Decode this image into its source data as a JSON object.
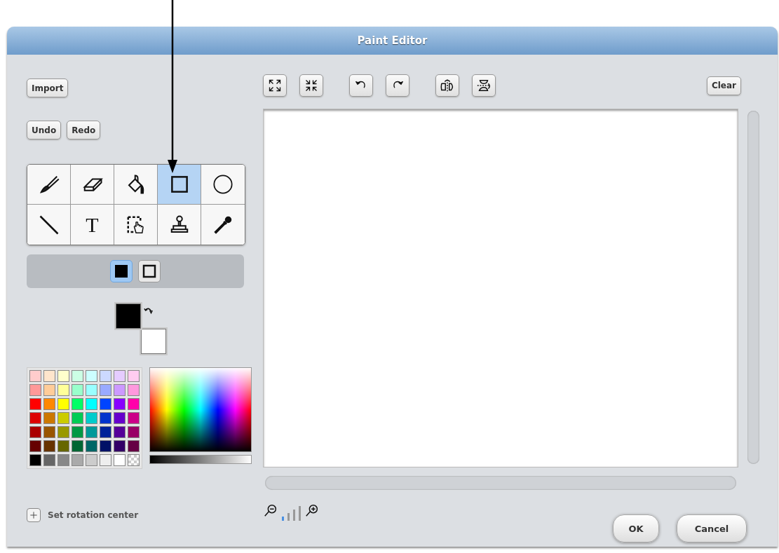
{
  "window": {
    "title": "Paint Editor"
  },
  "left_buttons": [
    {
      "label": "Import"
    },
    {
      "label": "Undo"
    },
    {
      "label": "Redo"
    }
  ],
  "tools": [
    {
      "kind": "brush",
      "selected": false
    },
    {
      "kind": "eraser",
      "selected": false
    },
    {
      "kind": "fill",
      "selected": false
    },
    {
      "kind": "rectangle",
      "selected": true
    },
    {
      "kind": "ellipse",
      "selected": false
    },
    {
      "kind": "line",
      "selected": false
    },
    {
      "kind": "text",
      "label": "T",
      "selected": false
    },
    {
      "kind": "select",
      "selected": false
    },
    {
      "kind": "stamp",
      "selected": false
    },
    {
      "kind": "eyedropper",
      "selected": false
    }
  ],
  "fill_modes": [
    {
      "kind": "filled",
      "selected": true
    },
    {
      "kind": "outline",
      "selected": false
    }
  ],
  "current_colors": [
    {
      "color": "#000000"
    },
    {
      "color": "#ffffff"
    }
  ],
  "palette": [
    {
      "kind": "solid",
      "color": "#ffcccc"
    },
    {
      "kind": "solid",
      "color": "#ffe5cc"
    },
    {
      "kind": "solid",
      "color": "#ffffcc"
    },
    {
      "kind": "solid",
      "color": "#ccffe5"
    },
    {
      "kind": "solid",
      "color": "#ccffff"
    },
    {
      "kind": "solid",
      "color": "#ccd9ff"
    },
    {
      "kind": "solid",
      "color": "#e5ccff"
    },
    {
      "kind": "solid",
      "color": "#ffccf0"
    },
    {
      "kind": "solid",
      "color": "#ff9999"
    },
    {
      "kind": "solid",
      "color": "#ffcc99"
    },
    {
      "kind": "solid",
      "color": "#ffff99"
    },
    {
      "kind": "solid",
      "color": "#99ffcc"
    },
    {
      "kind": "solid",
      "color": "#99ffff"
    },
    {
      "kind": "solid",
      "color": "#99aaff"
    },
    {
      "kind": "solid",
      "color": "#cc99ff"
    },
    {
      "kind": "solid",
      "color": "#ff99dd"
    },
    {
      "kind": "solid",
      "color": "#ff0000"
    },
    {
      "kind": "solid",
      "color": "#ff8800"
    },
    {
      "kind": "solid",
      "color": "#ffff00"
    },
    {
      "kind": "solid",
      "color": "#00ff66"
    },
    {
      "kind": "solid",
      "color": "#00ffff"
    },
    {
      "kind": "solid",
      "color": "#0044ff"
    },
    {
      "kind": "solid",
      "color": "#8800ff"
    },
    {
      "kind": "solid",
      "color": "#ff00aa"
    },
    {
      "kind": "solid",
      "color": "#dd0000"
    },
    {
      "kind": "solid",
      "color": "#cc7700"
    },
    {
      "kind": "solid",
      "color": "#cccc00"
    },
    {
      "kind": "solid",
      "color": "#00cc55"
    },
    {
      "kind": "solid",
      "color": "#00cccc"
    },
    {
      "kind": "solid",
      "color": "#0033cc"
    },
    {
      "kind": "solid",
      "color": "#6600cc"
    },
    {
      "kind": "solid",
      "color": "#cc0088"
    },
    {
      "kind": "solid",
      "color": "#aa0000"
    },
    {
      "kind": "solid",
      "color": "#995500"
    },
    {
      "kind": "solid",
      "color": "#999900"
    },
    {
      "kind": "solid",
      "color": "#009944"
    },
    {
      "kind": "solid",
      "color": "#009999"
    },
    {
      "kind": "solid",
      "color": "#002299"
    },
    {
      "kind": "solid",
      "color": "#550099"
    },
    {
      "kind": "solid",
      "color": "#990066"
    },
    {
      "kind": "solid",
      "color": "#660000"
    },
    {
      "kind": "solid",
      "color": "#663300"
    },
    {
      "kind": "solid",
      "color": "#666600"
    },
    {
      "kind": "solid",
      "color": "#006633"
    },
    {
      "kind": "solid",
      "color": "#006666"
    },
    {
      "kind": "solid",
      "color": "#001166"
    },
    {
      "kind": "solid",
      "color": "#330066"
    },
    {
      "kind": "solid",
      "color": "#660044"
    },
    {
      "kind": "solid",
      "color": "#000000"
    },
    {
      "kind": "solid",
      "color": "#666666"
    },
    {
      "kind": "solid",
      "color": "#888888"
    },
    {
      "kind": "solid",
      "color": "#aaaaaa"
    },
    {
      "kind": "solid",
      "color": "#cccccc"
    },
    {
      "kind": "solid",
      "color": "#eeeeee"
    },
    {
      "kind": "solid",
      "color": "#ffffff"
    },
    {
      "kind": "transparent"
    }
  ],
  "rotation_center": {
    "label": "Set rotation center"
  },
  "toolbar": [
    {
      "kind": "grow"
    },
    {
      "kind": "shrink"
    },
    {
      "kind": "rotate-left"
    },
    {
      "kind": "rotate-right"
    },
    {
      "kind": "flip-horizontal"
    },
    {
      "kind": "flip-vertical"
    }
  ],
  "clear_button": {
    "label": "Clear"
  },
  "dialog_buttons": [
    {
      "label": "OK"
    },
    {
      "label": "Cancel"
    }
  ]
}
